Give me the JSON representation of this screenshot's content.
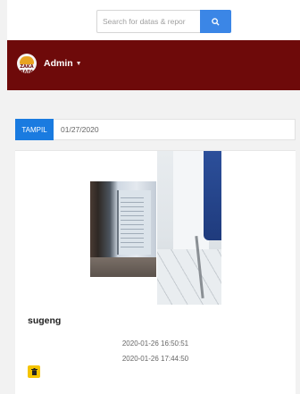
{
  "search": {
    "placeholder": "Search for datas & repor"
  },
  "header": {
    "logo_text": "ZAKA BAPA",
    "user_label": "Admin"
  },
  "filter": {
    "button_label": "TAMPIL",
    "date_value": "01/27/2020"
  },
  "card": {
    "name": "sugeng",
    "time_in": "2020-01-26 16:50:51",
    "time_out": "2020-01-26 17:44:50"
  },
  "colors": {
    "navbar": "#6e0a0a",
    "primary": "#1a7be0",
    "search_button": "#3b86e6",
    "delete_button": "#f5c400"
  },
  "icons": {
    "search": "search-icon",
    "delete": "trash-icon",
    "user_menu": "chevron-down-icon"
  }
}
